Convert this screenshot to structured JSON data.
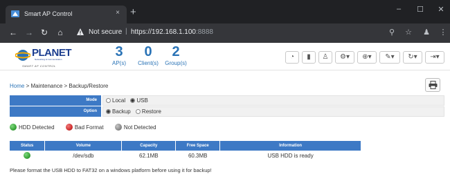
{
  "browser": {
    "tab_title": "Smart AP Control",
    "tab_close": "×",
    "new_tab": "+",
    "security_label": "Not secure",
    "separator": "|",
    "url_main": "https://192.168.1.100",
    "url_port": ":8888",
    "window_controls": {
      "minimize": "–",
      "maximize": "☐",
      "close": "✕"
    }
  },
  "header": {
    "logo_text": "PLANET",
    "logo_subtext": "Networking & Communication",
    "logo_tagline": "SMART AP CONTROL",
    "stats": [
      {
        "value": "3",
        "label": "AP(s)"
      },
      {
        "value": "0",
        "label": "Client(s)"
      },
      {
        "value": "2",
        "label": "Group(s)"
      }
    ],
    "icons": [
      "dashboard-icon",
      "chart-icon",
      "user-icon",
      "settings-icon",
      "globe-icon",
      "tools-icon",
      "refresh-icon",
      "logout-icon"
    ]
  },
  "breadcrumb": {
    "home": "Home",
    "path": " > Maintenance > Backup/Restore"
  },
  "form": {
    "mode": {
      "label": "Mode",
      "options": [
        "Local",
        "USB"
      ],
      "selected": "USB"
    },
    "option": {
      "label": "Option",
      "options": [
        "Backup",
        "Restore"
      ],
      "selected": "Backup"
    }
  },
  "legend": [
    {
      "label": "HDD Detected",
      "color": "#3aa53a"
    },
    {
      "label": "Bad Format",
      "color": "#d03030"
    },
    {
      "label": "Not Detected",
      "color": "#8a8a8a"
    }
  ],
  "table": {
    "headers": [
      "Status",
      "Volume",
      "Capacity",
      "Free Space",
      "Information"
    ],
    "rows": [
      {
        "status_color": "#3aa53a",
        "volume": "/dev/sdb",
        "capacity": "62.1MB",
        "free_space": "60.3MB",
        "information": "USB HDD is ready"
      }
    ]
  },
  "note": "Please format the USB HDD to FAT32 on a windows platform before using it for backup!",
  "colors": {
    "accent": "#3d79c5",
    "link": "#2a73b6",
    "brand": "#1b3d8f"
  }
}
